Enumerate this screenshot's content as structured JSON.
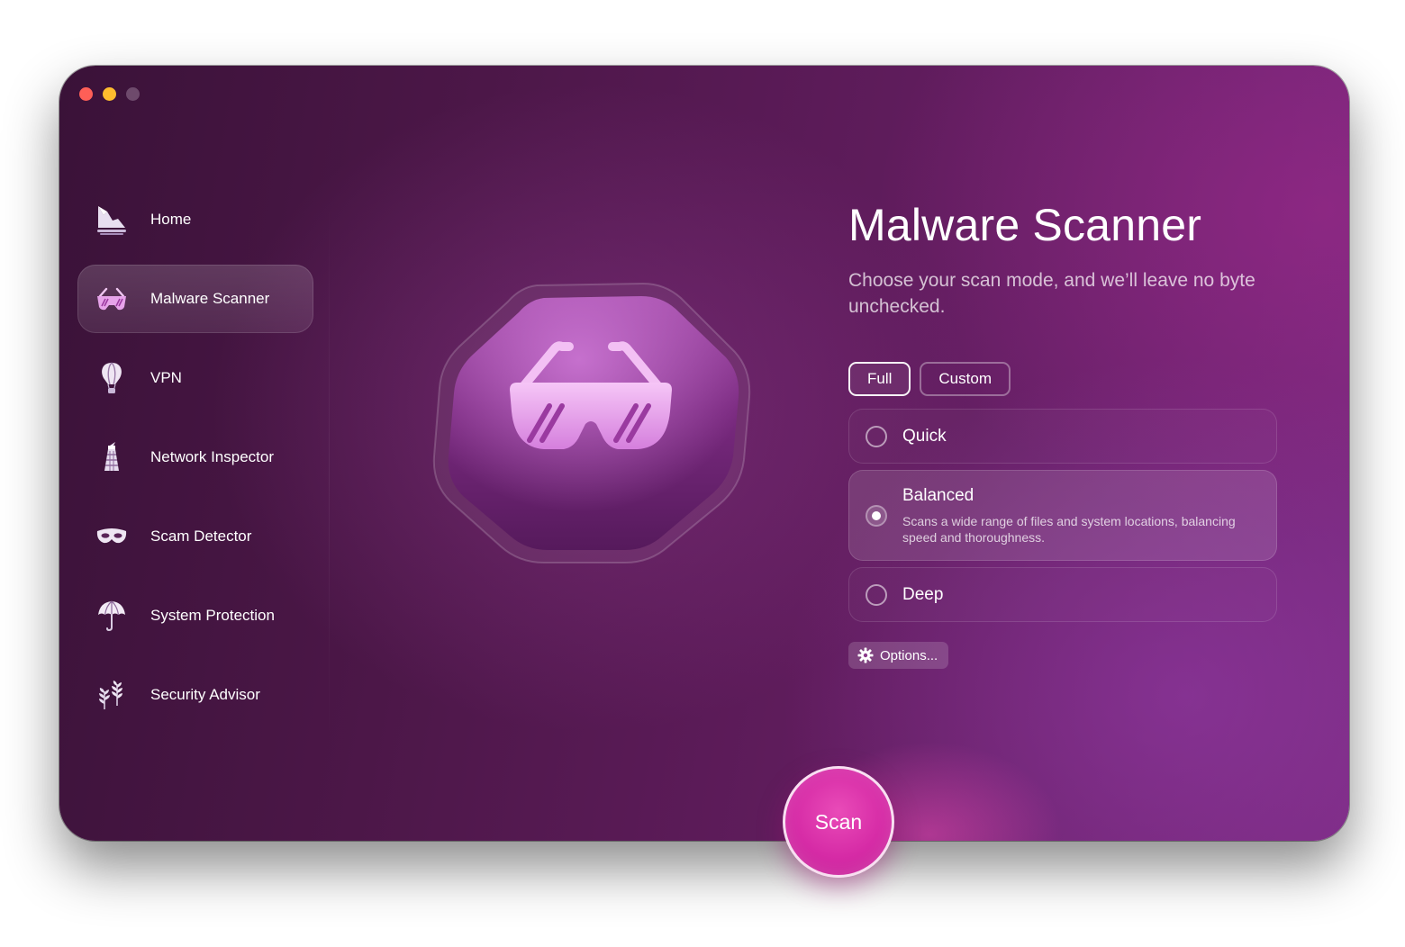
{
  "window": {
    "controls": [
      "close",
      "minimize",
      "zoom"
    ]
  },
  "sidebar": {
    "items": [
      {
        "label": "Home",
        "icon": "home-icon",
        "active": false
      },
      {
        "label": "Malware Scanner",
        "icon": "sunglasses-icon",
        "active": true
      },
      {
        "label": "VPN",
        "icon": "hot-air-balloon-icon",
        "active": false
      },
      {
        "label": "Network Inspector",
        "icon": "lighthouse-icon",
        "active": false
      },
      {
        "label": "Scam Detector",
        "icon": "mask-icon",
        "active": false
      },
      {
        "label": "System Protection",
        "icon": "umbrella-icon",
        "active": false
      },
      {
        "label": "Security Advisor",
        "icon": "leaves-icon",
        "active": false
      }
    ]
  },
  "main": {
    "title": "Malware Scanner",
    "subtitle": "Choose your scan mode, and we’ll leave no byte unchecked.",
    "mode_tabs": [
      {
        "label": "Full",
        "selected": true
      },
      {
        "label": "Custom",
        "selected": false
      }
    ],
    "scan_options": [
      {
        "label": "Quick",
        "selected": false
      },
      {
        "label": "Balanced",
        "selected": true,
        "description": "Scans a wide range of files and system locations, balancing speed and thoroughness."
      },
      {
        "label": "Deep",
        "selected": false
      }
    ],
    "options_button": "Options...",
    "scan_button": "Scan"
  },
  "colors": {
    "accent": "#d62ba6",
    "background_dark": "#3a1238",
    "background_light": "#7a2a80",
    "close": "#fe5f57",
    "minimize": "#febc2e"
  }
}
